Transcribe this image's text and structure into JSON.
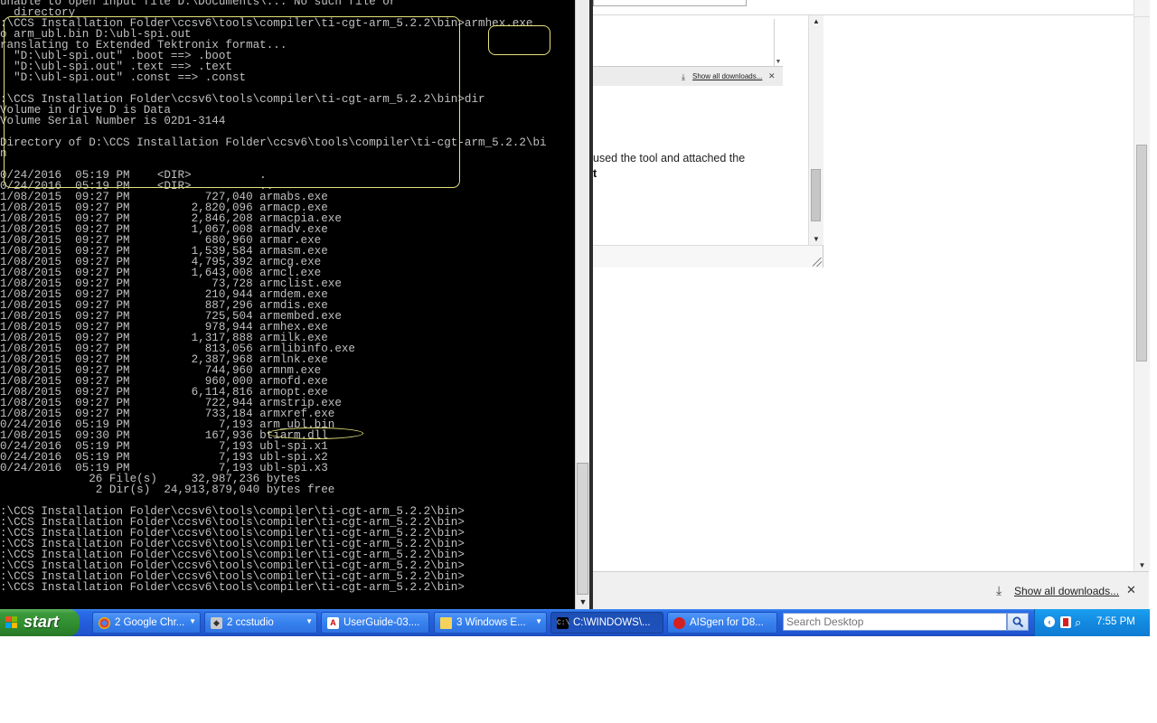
{
  "console": {
    "lines": [
      "unable to open input file D:\\Documents\\... No such file or",
      "  directory",
      ":\\CCS Installation Folder\\ccsv6\\tools\\compiler\\ti-cgt-arm_5.2.2\\bin>armhex.exe",
      "o arm_ubl.bin D:\\ubl-spi.out",
      "ranslating to Extended Tektronix format...",
      "  \"D:\\ubl-spi.out\" .boot ==> .boot",
      "  \"D:\\ubl-spi.out\" .text ==> .text",
      "  \"D:\\ubl-spi.out\" .const ==> .const",
      "",
      ":\\CCS Installation Folder\\ccsv6\\tools\\compiler\\ti-cgt-arm_5.2.2\\bin>dir",
      "Volume in drive D is Data",
      "Volume Serial Number is 02D1-3144",
      "",
      "Directory of D:\\CCS Installation Folder\\ccsv6\\tools\\compiler\\ti-cgt-arm_5.2.2\\bi",
      "n",
      "",
      "0/24/2016  05:19 PM    <DIR>          .",
      "0/24/2016  05:19 PM    <DIR>          ..",
      "1/08/2015  09:27 PM           727,040 armabs.exe",
      "1/08/2015  09:27 PM         2,820,096 armacp.exe",
      "1/08/2015  09:27 PM         2,846,208 armacpia.exe",
      "1/08/2015  09:27 PM         1,067,008 armadv.exe",
      "1/08/2015  09:27 PM           680,960 armar.exe",
      "1/08/2015  09:27 PM         1,539,584 armasm.exe",
      "1/08/2015  09:27 PM         4,795,392 armcg.exe",
      "1/08/2015  09:27 PM         1,643,008 armcl.exe",
      "1/08/2015  09:27 PM            73,728 armclist.exe",
      "1/08/2015  09:27 PM           210,944 armdem.exe",
      "1/08/2015  09:27 PM           887,296 armdis.exe",
      "1/08/2015  09:27 PM           725,504 armembed.exe",
      "1/08/2015  09:27 PM           978,944 armhex.exe",
      "1/08/2015  09:27 PM         1,317,888 armilk.exe",
      "1/08/2015  09:27 PM           813,056 armlibinfo.exe",
      "1/08/2015  09:27 PM         2,387,968 armlnk.exe",
      "1/08/2015  09:27 PM           744,960 armnm.exe",
      "1/08/2015  09:27 PM           960,000 armofd.exe",
      "1/08/2015  09:27 PM         6,114,816 armopt.exe",
      "1/08/2015  09:27 PM           722,944 armstrip.exe",
      "1/08/2015  09:27 PM           733,184 armxref.exe",
      "0/24/2016  05:19 PM             7,193 arm_ubl.bin",
      "1/08/2015  09:30 PM           167,936 btiarm.dll",
      "0/24/2016  05:19 PM             7,193 ubl-spi.x1",
      "0/24/2016  05:19 PM             7,193 ubl-spi.x2",
      "0/24/2016  05:19 PM             7,193 ubl-spi.x3",
      "             26 File(s)     32,987,236 bytes",
      "              2 Dir(s)  24,913,879,040 bytes free",
      "",
      ":\\CCS Installation Folder\\ccsv6\\tools\\compiler\\ti-cgt-arm_5.2.2\\bin>",
      ":\\CCS Installation Folder\\ccsv6\\tools\\compiler\\ti-cgt-arm_5.2.2\\bin>",
      ":\\CCS Installation Folder\\ccsv6\\tools\\compiler\\ti-cgt-arm_5.2.2\\bin>",
      ":\\CCS Installation Folder\\ccsv6\\tools\\compiler\\ti-cgt-arm_5.2.2\\bin>",
      ":\\CCS Installation Folder\\ccsv6\\tools\\compiler\\ti-cgt-arm_5.2.2\\bin>",
      ":\\CCS Installation Folder\\ccsv6\\tools\\compiler\\ti-cgt-arm_5.2.2\\bin>",
      ":\\CCS Installation Folder\\ccsv6\\tools\\compiler\\ti-cgt-arm_5.2.2\\bin>",
      ":\\CCS Installation Folder\\ccsv6\\tools\\compiler\\ti-cgt-arm_5.2.2\\bin>"
    ]
  },
  "browser": {
    "inner_download_link": "Show all downloads...",
    "text_fragment_1": "used the tool and attached the",
    "text_fragment_2": "t",
    "download_bar_link": "Show all downloads...",
    "close_glyph": "✕"
  },
  "taskbar": {
    "start_label": "start",
    "buttons": [
      {
        "label": "2 Google Chr...",
        "icon": "chrome-icon",
        "caret": true,
        "active": false
      },
      {
        "label": "2 ccstudio",
        "icon": "ccstudio-icon",
        "caret": true,
        "active": false
      },
      {
        "label": "UserGuide-03....",
        "icon": "pdf-icon",
        "caret": false,
        "active": false
      },
      {
        "label": "3 Windows E...",
        "icon": "folder-icon",
        "caret": true,
        "active": false
      },
      {
        "label": "C:\\WINDOWS\\...",
        "icon": "cmd-icon",
        "caret": false,
        "active": true
      },
      {
        "label": "AISgen for D8...",
        "icon": "aisgen-icon",
        "caret": false,
        "active": false
      }
    ],
    "search_placeholder": "Search Desktop",
    "clock": "7:55 PM"
  },
  "colors": {
    "console_bg": "#000000",
    "console_text": "#c0c0c0",
    "annotation": "#e6e27a",
    "taskbar_blue": "#245edb",
    "start_green": "#3c9a3c",
    "tray_blue": "#1389e0"
  }
}
